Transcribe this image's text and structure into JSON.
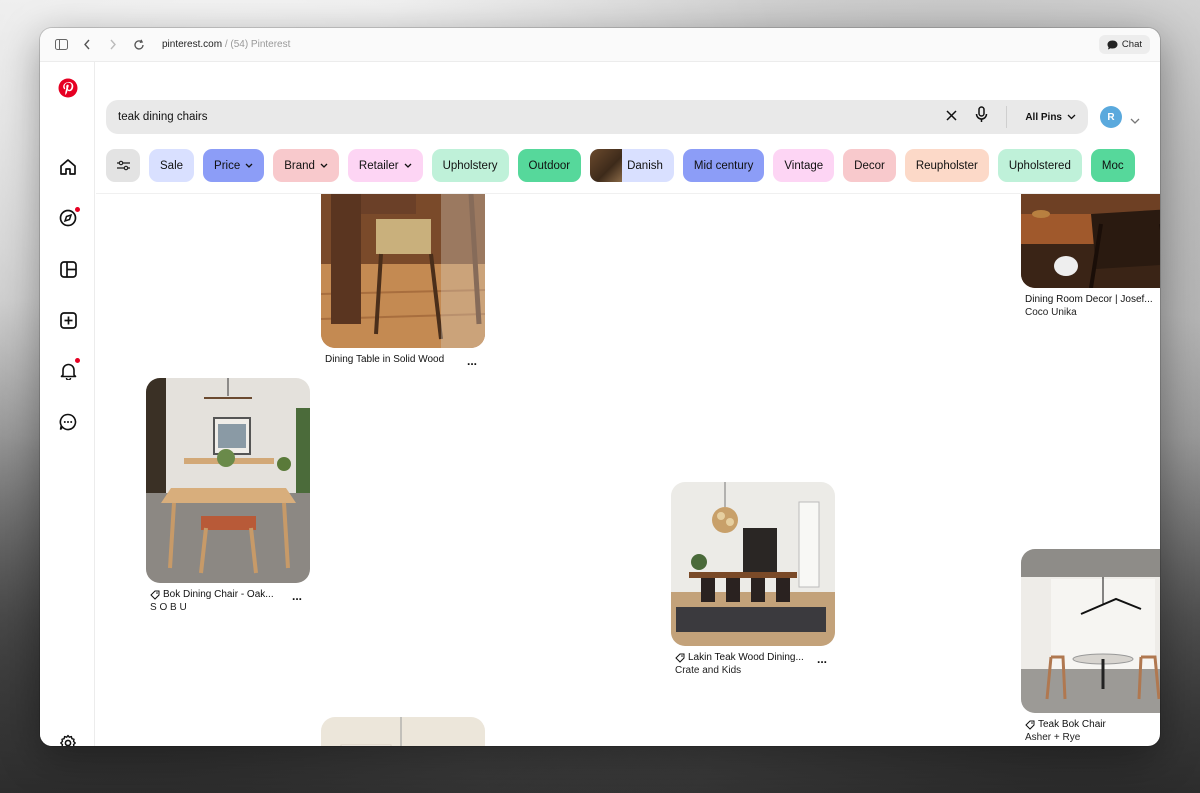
{
  "browser": {
    "url_domain": "pinterest.com",
    "url_separator": "/",
    "page_title": "(54) Pinterest",
    "chat_label": "Chat"
  },
  "search": {
    "query": "teak dining chairs",
    "scope_label": "All Pins"
  },
  "account": {
    "initial": "R"
  },
  "chips": [
    {
      "label": "Sale",
      "color": "#d9e0ff",
      "dropdown": false
    },
    {
      "label": "Price",
      "color": "#8c9df7",
      "dropdown": true
    },
    {
      "label": "Brand",
      "color": "#f8c9cc",
      "dropdown": true
    },
    {
      "label": "Retailer",
      "color": "#fdd5f4",
      "dropdown": true
    },
    {
      "label": "Upholstery",
      "color": "#bff1d9",
      "dropdown": false
    },
    {
      "label": "Outdoor",
      "color": "#56d89b",
      "dropdown": false
    },
    {
      "label": "Danish",
      "color": "#d9e0ff",
      "dropdown": false,
      "thumb": true
    },
    {
      "label": "Mid century",
      "color": "#8c9df7",
      "dropdown": false
    },
    {
      "label": "Vintage",
      "color": "#fdd5f4",
      "dropdown": false
    },
    {
      "label": "Decor",
      "color": "#f8c9cc",
      "dropdown": false
    },
    {
      "label": "Reupholster",
      "color": "#fcd9c8",
      "dropdown": false
    },
    {
      "label": "Upholstered",
      "color": "#bff1d9",
      "dropdown": false
    },
    {
      "label": "Moc",
      "color": "#56d89b",
      "dropdown": false
    }
  ],
  "pins": [
    {
      "title": "Dining Table in Solid Wood",
      "subtitle": "",
      "tagged": false
    },
    {
      "title": "Dining Room Decor | Josef...",
      "subtitle": "Coco Unika",
      "tagged": false
    },
    {
      "title": "Bok Dining Chair - Oak...",
      "subtitle": "S O B U",
      "tagged": true
    },
    {
      "title": "Lakin Teak Wood Dining...",
      "subtitle": "Crate and Kids",
      "tagged": true
    },
    {
      "title": "Teak Bok Chair",
      "subtitle": "Asher + Rye",
      "tagged": true
    }
  ],
  "more_label": "..."
}
